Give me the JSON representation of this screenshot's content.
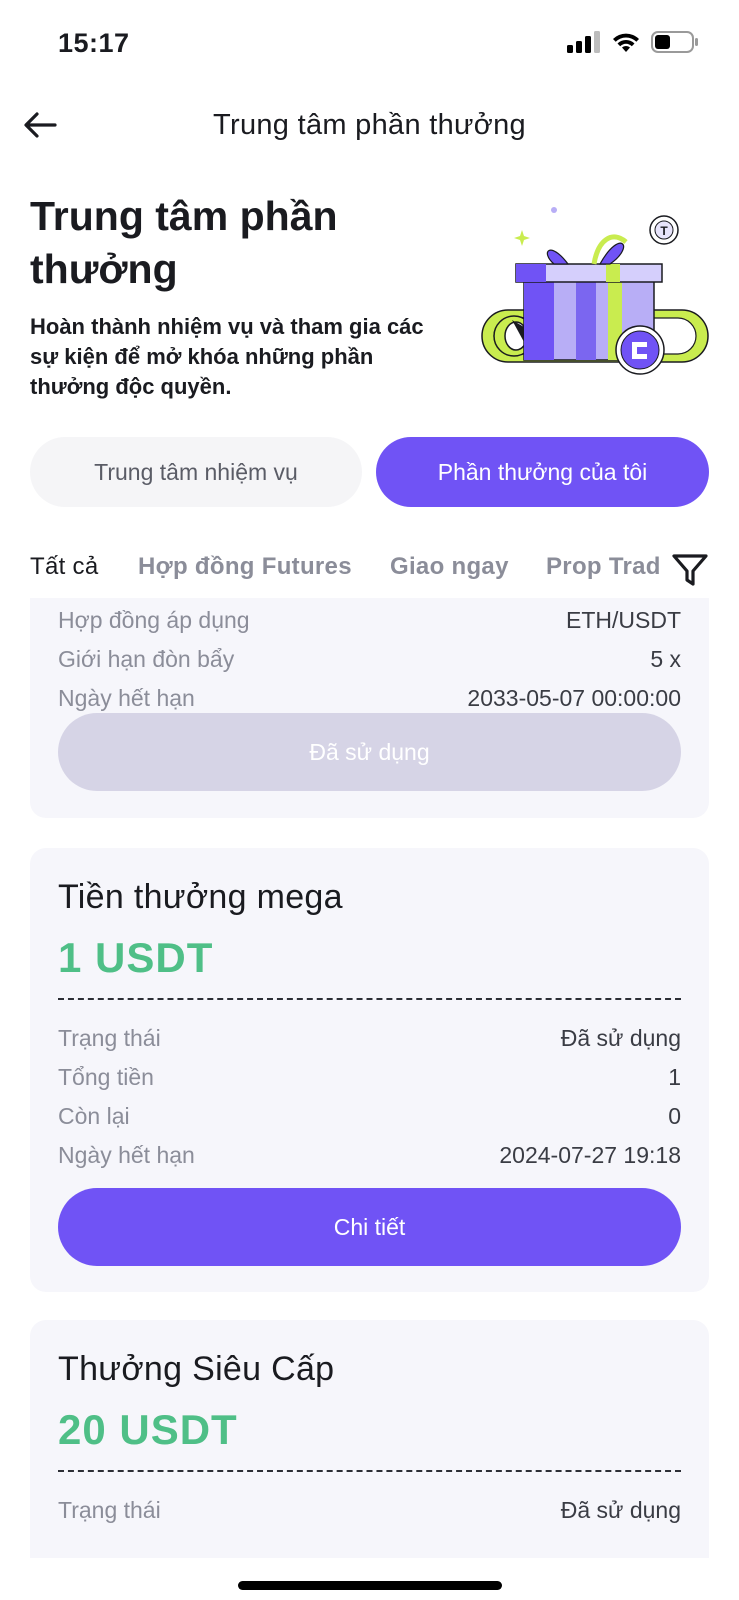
{
  "status": {
    "time": "15:17",
    "icons": [
      "signal-icon",
      "wifi-icon",
      "battery-icon"
    ]
  },
  "nav": {
    "title": "Trung tâm phần thưởng",
    "back_icon": "arrow-left-icon"
  },
  "hero": {
    "title": "Trung tâm phần thưởng",
    "description": "Hoàn thành nhiệm vụ và tham gia các sự kiện để mở khóa những phần thưởng độc quyền.",
    "illustration": "gift-box-illustration"
  },
  "segments": {
    "left": "Trung tâm nhiệm vụ",
    "right": "Phần thưởng của tôi",
    "selected": "right"
  },
  "filters": {
    "tabs": [
      "Tất cả",
      "Hợp đồng Futures",
      "Giao ngay",
      "Prop Trad"
    ],
    "active_index": 0,
    "icon": "filter-icon"
  },
  "cards": [
    {
      "rows": [
        {
          "label": "Hợp đồng áp dụng",
          "value": "ETH/USDT"
        },
        {
          "label": "Giới hạn đòn bẩy",
          "value": "5 x"
        },
        {
          "label": "Ngày hết hạn",
          "value": "2033-05-07 00:00:00"
        }
      ],
      "button": "Đã sử dụng"
    },
    {
      "title": "Tiền thưởng mega",
      "amount": "1 USDT",
      "rows": [
        {
          "label": "Trạng thái",
          "value": "Đã sử dụng"
        },
        {
          "label": "Tổng tiền",
          "value": "1"
        },
        {
          "label": "Còn lại",
          "value": "0"
        },
        {
          "label": "Ngày hết hạn",
          "value": "2024-07-27 19:18"
        }
      ],
      "button": "Chi tiết"
    },
    {
      "title": "Thưởng Siêu Cấp",
      "amount": "20 USDT",
      "rows": [
        {
          "label": "Trạng thái",
          "value": "Đã sử dụng"
        }
      ]
    }
  ],
  "colors": {
    "accent": "#7053f5",
    "amount_green": "#4fbf87",
    "card_bg": "#f6f6fb",
    "used_button": "#d6d4e6"
  }
}
